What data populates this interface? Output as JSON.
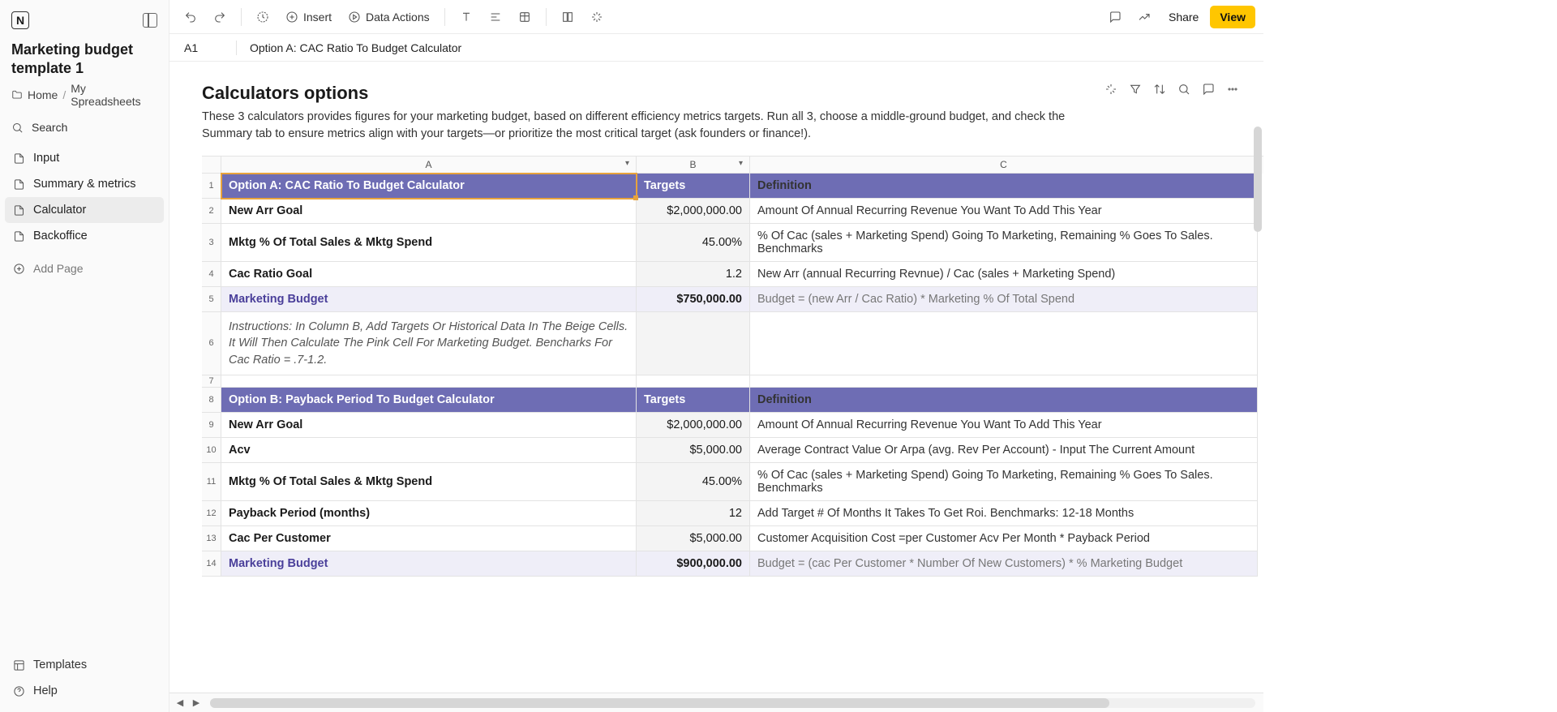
{
  "app": {
    "logo_letter": "N"
  },
  "doc": {
    "title": "Marketing budget template 1",
    "breadcrumb": {
      "home": "Home",
      "folder": "My Spreadsheets"
    }
  },
  "sidebar": {
    "search_label": "Search",
    "items": [
      {
        "label": "Input"
      },
      {
        "label": "Summary & metrics"
      },
      {
        "label": "Calculator"
      },
      {
        "label": "Backoffice"
      }
    ],
    "add_page": "Add Page",
    "templates": "Templates",
    "help": "Help"
  },
  "toolbar": {
    "insert": "Insert",
    "data_actions": "Data Actions",
    "share": "Share",
    "view": "View"
  },
  "formula_bar": {
    "cell_ref": "A1",
    "value": "Option A: CAC Ratio To Budget Calculator"
  },
  "page": {
    "title": "Calculators options",
    "description": "These 3 calculators provides figures for your marketing budget, based on different efficiency metrics targets. Run all 3, choose a middle-ground budget, and check the Summary tab to ensure metrics align with your targets—or prioritize the most critical target (ask founders or finance!)."
  },
  "columns": {
    "A": "A",
    "B": "B",
    "C": "C"
  },
  "rows": [
    {
      "n": "1",
      "type": "header",
      "a": "Option A: CAC Ratio To Budget Calculator",
      "b": "Targets",
      "c": "Definition",
      "selected": true
    },
    {
      "n": "2",
      "type": "data",
      "a": "New Arr Goal",
      "b": "$2,000,000.00",
      "c": "Amount Of Annual Recurring Revenue You Want To Add This Year"
    },
    {
      "n": "3",
      "type": "data",
      "a": "Mktg % Of Total Sales & Mktg Spend",
      "b": "45.00%",
      "c": "% Of Cac (sales + Marketing Spend) Going To Marketing, Remaining % Goes To Sales. Benchmarks"
    },
    {
      "n": "4",
      "type": "data",
      "a": "Cac Ratio Goal",
      "b": "1.2",
      "c": "New Arr (annual Recurring Revnue) / Cac (sales + Marketing Spend)"
    },
    {
      "n": "5",
      "type": "budget",
      "a": "Marketing Budget",
      "b": "$750,000.00",
      "c": "Budget = (new Arr / Cac Ratio) * Marketing % Of Total Spend"
    },
    {
      "n": "6",
      "type": "instr",
      "a": "Instructions: In Column B, Add Targets Or Historical Data In The Beige Cells. It Will Then Calculate The Pink Cell For Marketing Budget. Bencharks For Cac Ratio = .7-1.2.",
      "b": "",
      "c": ""
    },
    {
      "n": "7",
      "type": "empty",
      "a": "",
      "b": "",
      "c": ""
    },
    {
      "n": "8",
      "type": "header",
      "a": "Option B: Payback Period To Budget Calculator",
      "b": "Targets",
      "c": "Definition"
    },
    {
      "n": "9",
      "type": "data",
      "a": "New Arr Goal",
      "b": "$2,000,000.00",
      "c": "Amount Of Annual Recurring Revenue You Want To Add This Year"
    },
    {
      "n": "10",
      "type": "data",
      "a": "Acv",
      "b": "$5,000.00",
      "c": "Average Contract Value Or Arpa (avg. Rev Per Account) - Input The Current Amount"
    },
    {
      "n": "11",
      "type": "data",
      "a": "Mktg % Of Total Sales & Mktg Spend",
      "b": "45.00%",
      "c": "% Of Cac (sales + Marketing Spend) Going To Marketing, Remaining % Goes To Sales. Benchmarks"
    },
    {
      "n": "12",
      "type": "data",
      "a": "Payback Period (months)",
      "b": "12",
      "c": "Add Target # Of Months It Takes To Get Roi. Benchmarks: 12-18 Months"
    },
    {
      "n": "13",
      "type": "data",
      "a": "Cac Per Customer",
      "b": "$5,000.00",
      "c": "Customer Acquisition Cost =per Customer Acv Per Month * Payback Period"
    },
    {
      "n": "14",
      "type": "budget",
      "a": "Marketing Budget",
      "b": "$900,000.00",
      "c": "Budget = (cac Per Customer * Number Of New Customers) * % Marketing Budget"
    }
  ]
}
